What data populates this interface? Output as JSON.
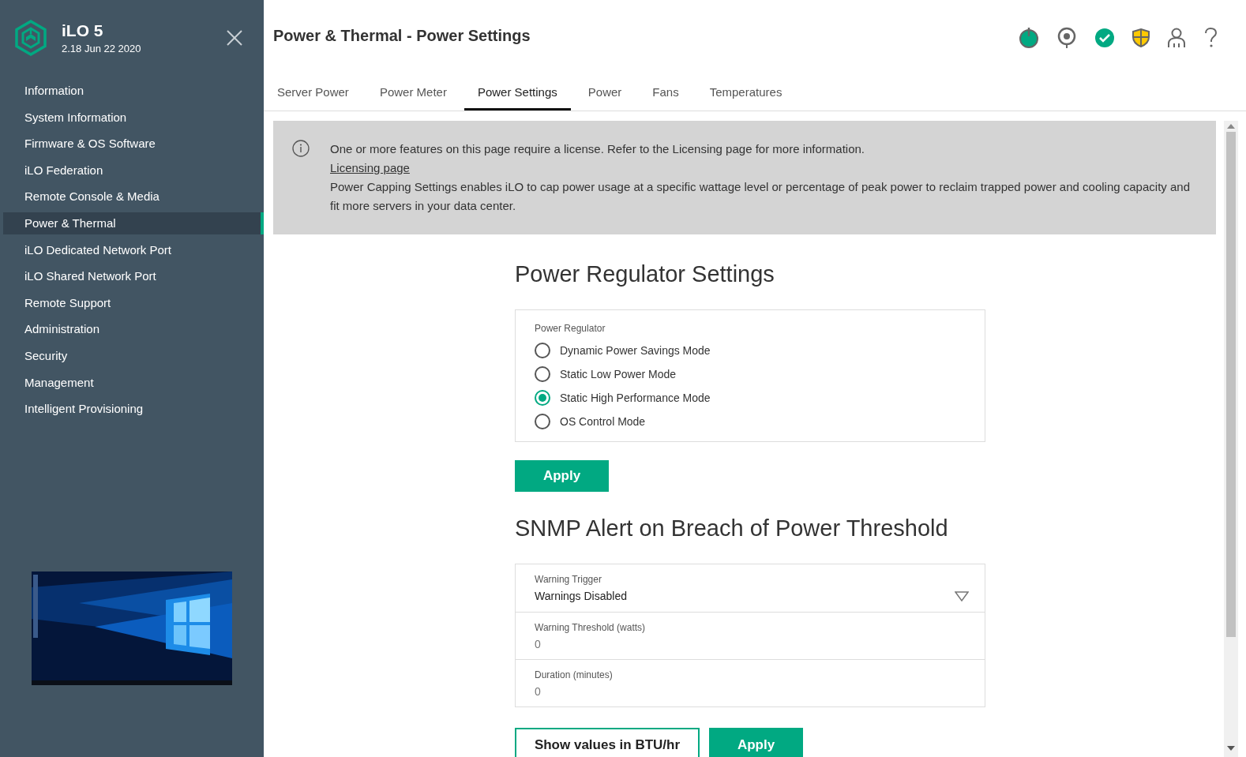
{
  "sidebar": {
    "product": "iLO 5",
    "version": "2.18 Jun 22 2020",
    "items": [
      {
        "label": "Information",
        "selected": false
      },
      {
        "label": "System Information",
        "selected": false
      },
      {
        "label": "Firmware & OS Software",
        "selected": false
      },
      {
        "label": "iLO Federation",
        "selected": false
      },
      {
        "label": "Remote Console & Media",
        "selected": false
      },
      {
        "label": "Power & Thermal",
        "selected": true
      },
      {
        "label": "iLO Dedicated Network Port",
        "selected": false
      },
      {
        "label": "iLO Shared Network Port",
        "selected": false
      },
      {
        "label": "Remote Support",
        "selected": false
      },
      {
        "label": "Administration",
        "selected": false
      },
      {
        "label": "Security",
        "selected": false
      },
      {
        "label": "Management",
        "selected": false
      },
      {
        "label": "Intelligent Provisioning",
        "selected": false
      }
    ]
  },
  "header": {
    "title": "Power & Thermal - Power Settings"
  },
  "tabs": [
    {
      "label": "Server Power",
      "selected": false
    },
    {
      "label": "Power Meter",
      "selected": false
    },
    {
      "label": "Power Settings",
      "selected": true
    },
    {
      "label": "Power",
      "selected": false
    },
    {
      "label": "Fans",
      "selected": false
    },
    {
      "label": "Temperatures",
      "selected": false
    }
  ],
  "notice": {
    "message": "One or more features on this page require a license. Refer to the Licensing page for more information.",
    "link": "Licensing page",
    "description": "Power Capping Settings enables iLO to cap power usage at a specific wattage level or percentage of peak power to reclaim trapped power and cooling capacity and fit more servers in your data center."
  },
  "power_regulator": {
    "heading": "Power Regulator Settings",
    "legend": "Power Regulator",
    "options": [
      {
        "label": "Dynamic Power Savings Mode",
        "selected": false
      },
      {
        "label": "Static Low Power Mode",
        "selected": false
      },
      {
        "label": "Static High Performance Mode",
        "selected": true
      },
      {
        "label": "OS Control Mode",
        "selected": false
      }
    ],
    "apply": "Apply"
  },
  "snmp_alert": {
    "heading": "SNMP Alert on Breach of Power Threshold",
    "fields": [
      {
        "kind": "select",
        "label": "Warning Trigger",
        "value": "Warnings Disabled"
      },
      {
        "kind": "input",
        "label": "Warning Threshold (watts)",
        "value": "0"
      },
      {
        "kind": "input",
        "label": "Duration (minutes)",
        "value": "0"
      }
    ],
    "buttons": [
      {
        "kind": "outline",
        "label": "Show values in BTU/hr"
      },
      {
        "kind": "primary",
        "label": "Apply"
      }
    ]
  }
}
